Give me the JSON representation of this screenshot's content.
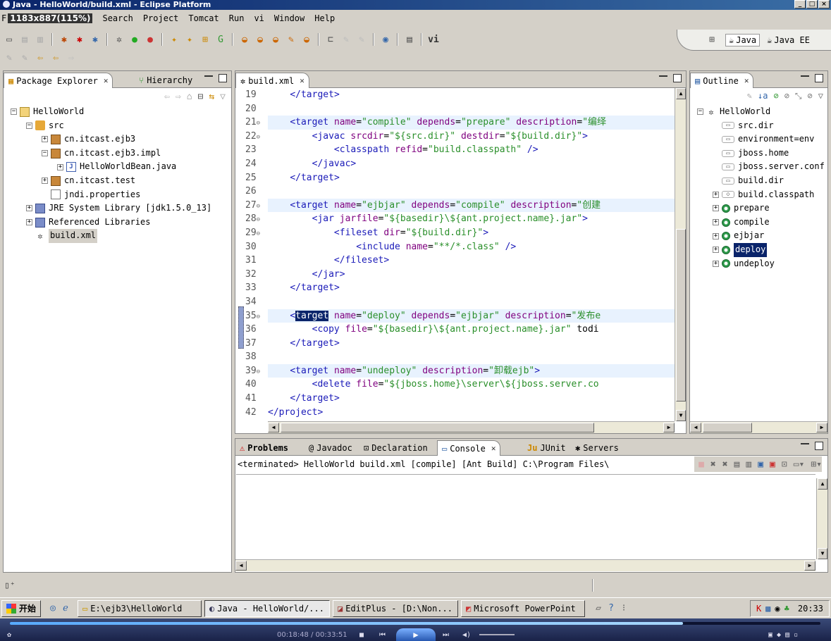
{
  "window": {
    "title": "Java - HelloWorld/build.xml - Eclipse Platform"
  },
  "overlay": {
    "resolution": "1183x887(115%)"
  },
  "menu": {
    "items": [
      "Search",
      "Project",
      "Tomcat",
      "Run",
      "vi",
      "Window",
      "Help"
    ]
  },
  "perspectives": {
    "java": "Java",
    "javaee": "Java EE"
  },
  "package_explorer": {
    "tab1": "Package Explorer",
    "tab2": "Hierarchy",
    "tree": [
      {
        "label": "HelloWorld",
        "depth": 0,
        "exp": "-",
        "icon": "project-icon"
      },
      {
        "label": "src",
        "depth": 1,
        "exp": "-",
        "icon": "source-folder-icon"
      },
      {
        "label": "cn.itcast.ejb3",
        "depth": 2,
        "exp": "+",
        "icon": "package-icon"
      },
      {
        "label": "cn.itcast.ejb3.impl",
        "depth": 2,
        "exp": "-",
        "icon": "package-icon"
      },
      {
        "label": "HelloWorldBean.java",
        "depth": 3,
        "exp": "+",
        "icon": "java-file-icon"
      },
      {
        "label": "cn.itcast.test",
        "depth": 2,
        "exp": "+",
        "icon": "package-icon"
      },
      {
        "label": "jndi.properties",
        "depth": 2,
        "exp": "",
        "icon": "properties-file-icon"
      },
      {
        "label": "JRE System Library [jdk1.5.0_13]",
        "depth": 1,
        "exp": "+",
        "icon": "library-icon"
      },
      {
        "label": "Referenced Libraries",
        "depth": 1,
        "exp": "+",
        "icon": "library-icon"
      },
      {
        "label": "build.xml",
        "depth": 1,
        "exp": "",
        "icon": "ant-file-icon",
        "selected": true
      }
    ]
  },
  "editor": {
    "tab": "build.xml",
    "lines": [
      {
        "n": "19",
        "text": "    </target>"
      },
      {
        "n": "20",
        "text": ""
      },
      {
        "n": "21",
        "text": "    <target name=\"compile\" depends=\"prepare\" description=\"编绎",
        "fold": true
      },
      {
        "n": "22",
        "text": "        <javac srcdir=\"${src.dir}\" destdir=\"${build.dir}\">",
        "fold": true
      },
      {
        "n": "23",
        "text": "            <classpath refid=\"build.classpath\" />"
      },
      {
        "n": "24",
        "text": "        </javac>"
      },
      {
        "n": "25",
        "text": "    </target>"
      },
      {
        "n": "26",
        "text": ""
      },
      {
        "n": "27",
        "text": "    <target name=\"ejbjar\" depends=\"compile\" description=\"创建",
        "fold": true
      },
      {
        "n": "28",
        "text": "        <jar jarfile=\"${basedir}\\${ant.project.name}.jar\">",
        "fold": true
      },
      {
        "n": "29",
        "text": "            <fileset dir=\"${build.dir}\">",
        "fold": true
      },
      {
        "n": "30",
        "text": "                <include name=\"**/*.class\" />"
      },
      {
        "n": "31",
        "text": "            </fileset>"
      },
      {
        "n": "32",
        "text": "        </jar>"
      },
      {
        "n": "33",
        "text": "    </target>"
      },
      {
        "n": "34",
        "text": ""
      },
      {
        "n": "35",
        "text": "    <target name=\"deploy\" depends=\"ejbjar\" description=\"发布e",
        "fold": true,
        "highlight": true
      },
      {
        "n": "36",
        "text": "        <copy file=\"${basedir}\\${ant.project.name}.jar\" todi"
      },
      {
        "n": "37",
        "text": "    </target>"
      },
      {
        "n": "38",
        "text": ""
      },
      {
        "n": "39",
        "text": "    <target name=\"undeploy\" description=\"卸载ejb\">",
        "fold": true
      },
      {
        "n": "40",
        "text": "        <delete file=\"${jboss.home}\\server\\${jboss.server.co"
      },
      {
        "n": "41",
        "text": "    </target>"
      },
      {
        "n": "42",
        "text": "</project>"
      }
    ]
  },
  "outline": {
    "tab": "Outline",
    "tree": [
      {
        "label": "HelloWorld",
        "depth": 0,
        "exp": "-",
        "icon": "ant-project-icon"
      },
      {
        "label": "src.dir",
        "depth": 1,
        "exp": "",
        "icon": "property-icon"
      },
      {
        "label": "environment=env",
        "depth": 1,
        "exp": "",
        "icon": "property-icon"
      },
      {
        "label": "jboss.home",
        "depth": 1,
        "exp": "",
        "icon": "property-icon"
      },
      {
        "label": "jboss.server.conf",
        "depth": 1,
        "exp": "",
        "icon": "property-icon"
      },
      {
        "label": "build.dir",
        "depth": 1,
        "exp": "",
        "icon": "property-icon"
      },
      {
        "label": "build.classpath",
        "depth": 1,
        "exp": "+",
        "icon": "path-icon"
      },
      {
        "label": "prepare",
        "depth": 1,
        "exp": "+",
        "icon": "target-icon"
      },
      {
        "label": "compile",
        "depth": 1,
        "exp": "+",
        "icon": "target-icon"
      },
      {
        "label": "ejbjar",
        "depth": 1,
        "exp": "+",
        "icon": "target-icon"
      },
      {
        "label": "deploy",
        "depth": 1,
        "exp": "+",
        "icon": "target-icon",
        "selected": true
      },
      {
        "label": "undeploy",
        "depth": 1,
        "exp": "+",
        "icon": "target-icon"
      }
    ]
  },
  "bottom_panel": {
    "tabs": [
      "Problems",
      "Javadoc",
      "Declaration",
      "Console",
      "JUnit",
      "Servers"
    ],
    "console_text": "<terminated> HelloWorld build.xml [compile] [Ant Build] C:\\Program Files\\"
  },
  "taskbar": {
    "start": "开始",
    "tasks": [
      {
        "label": "E:\\ejb3\\HelloWorld",
        "icon": "folder-icon"
      },
      {
        "label": "Java - HelloWorld/...",
        "icon": "eclipse-icon",
        "active": true
      },
      {
        "label": "EditPlus - [D:\\Non...",
        "icon": "editplus-icon"
      },
      {
        "label": "Microsoft PowerPoint",
        "icon": "powerpoint-icon"
      }
    ],
    "clock": "20:33"
  },
  "video": {
    "time": "00:18:48 / 00:33:51",
    "progress": 0.83
  }
}
